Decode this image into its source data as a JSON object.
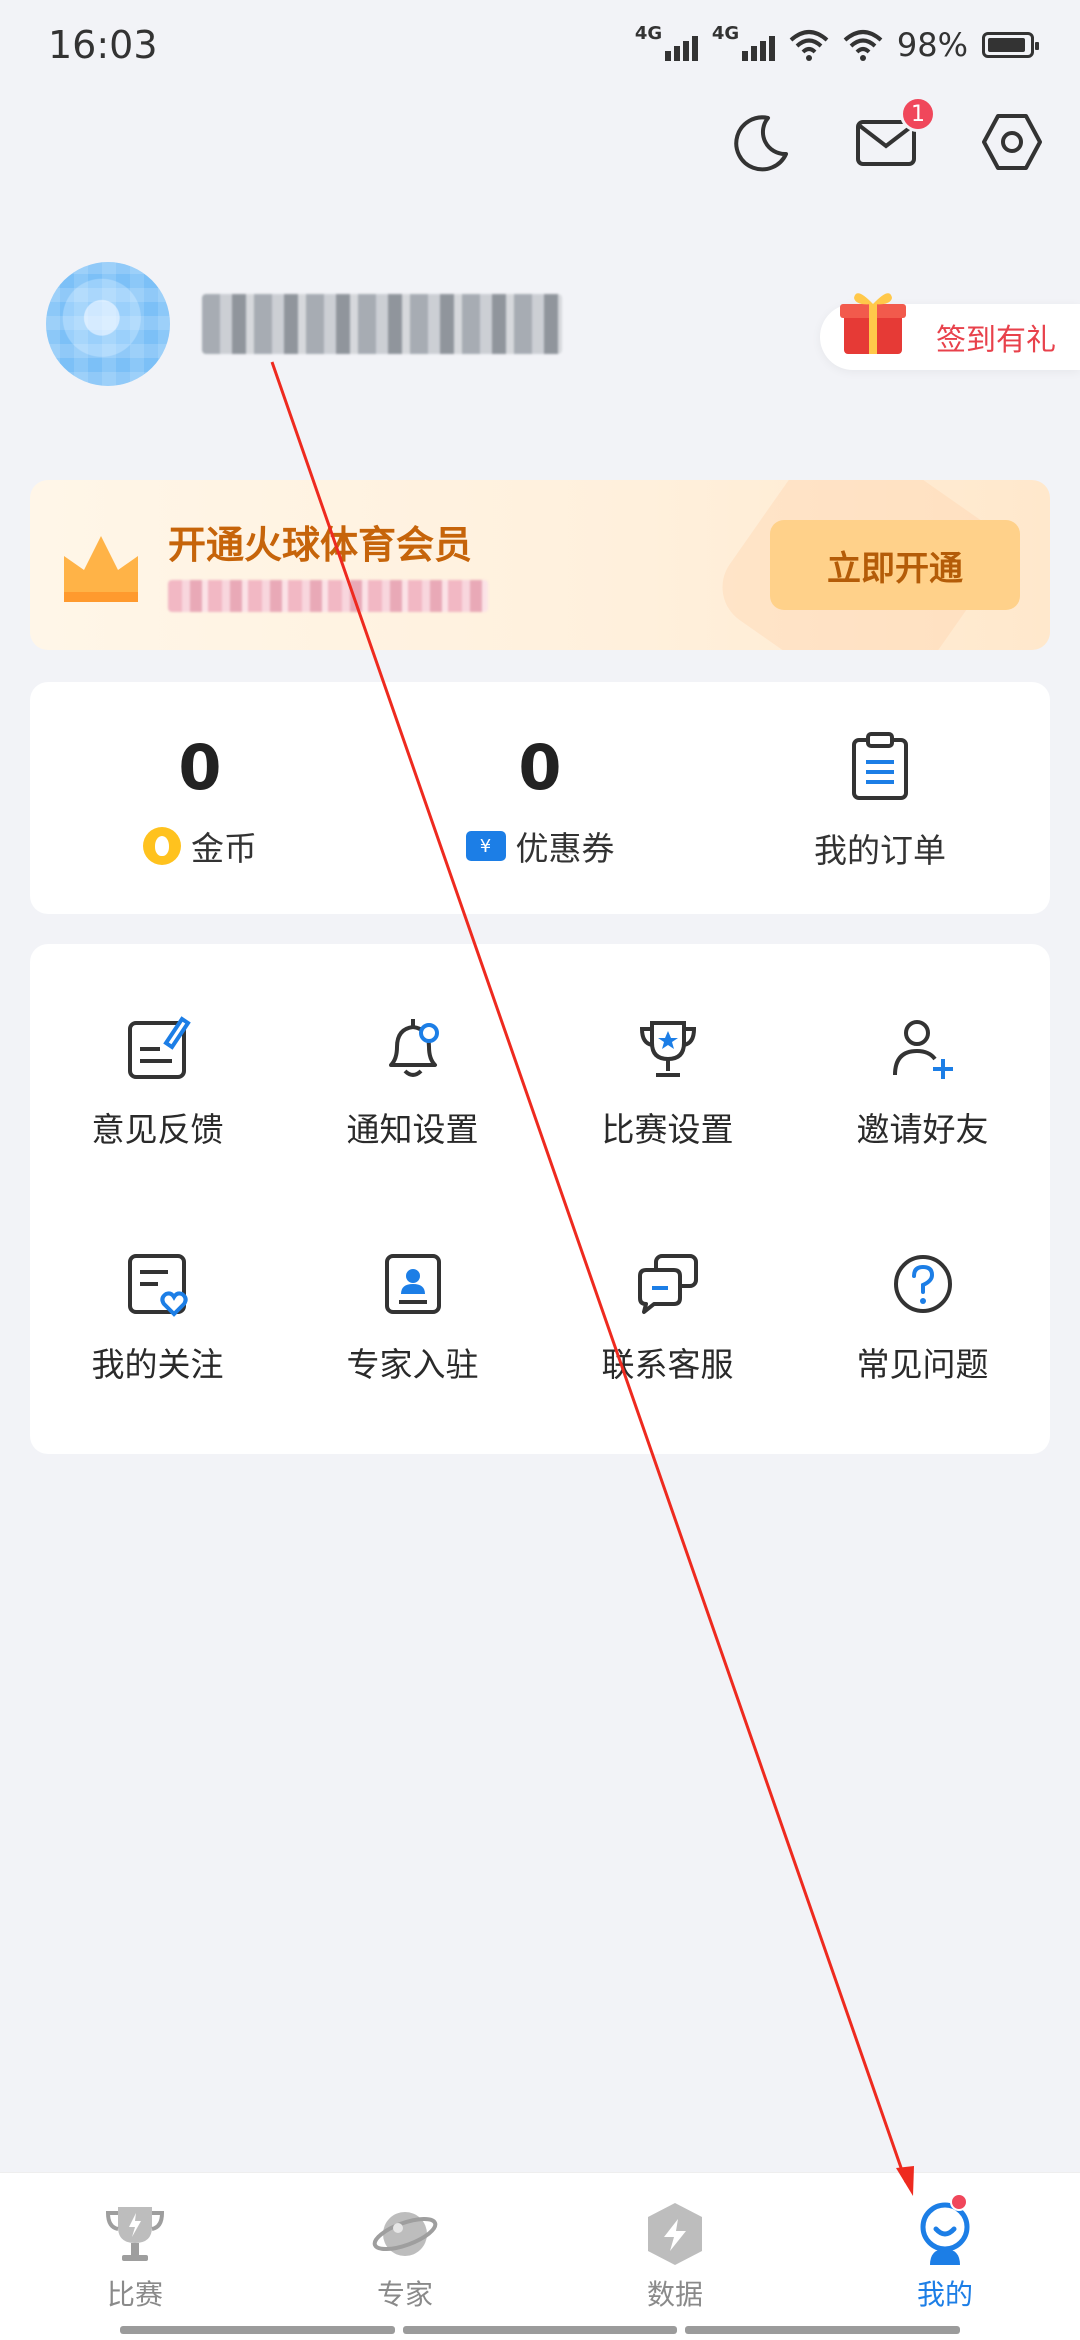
{
  "status": {
    "time": "16:03",
    "net1": "4G",
    "net2": "4G",
    "battery": "98%"
  },
  "signin": {
    "label": "签到有礼"
  },
  "vip": {
    "title": "开通火球体育会员",
    "button": "立即开通"
  },
  "stats": [
    {
      "value": "0",
      "label": "金币",
      "icon": "coin-icon"
    },
    {
      "value": "0",
      "label": "优惠券",
      "icon": "coupon-icon"
    },
    {
      "label": "我的订单",
      "icon": "clipboard-icon"
    }
  ],
  "grid": [
    {
      "label": "意见反馈",
      "icon": "feedback-icon"
    },
    {
      "label": "通知设置",
      "icon": "bell-icon"
    },
    {
      "label": "比赛设置",
      "icon": "trophy-icon"
    },
    {
      "label": "邀请好友",
      "icon": "add-user-icon"
    },
    {
      "label": "我的关注",
      "icon": "follow-icon"
    },
    {
      "label": "专家入驻",
      "icon": "expert-icon"
    },
    {
      "label": "联系客服",
      "icon": "chat-icon"
    },
    {
      "label": "常见问题",
      "icon": "question-icon"
    }
  ],
  "messages": {
    "badge": "1"
  },
  "tabs": [
    {
      "label": "比赛",
      "icon": "trophy-icon"
    },
    {
      "label": "专家",
      "icon": "planet-icon"
    },
    {
      "label": "数据",
      "icon": "data-icon"
    },
    {
      "label": "我的",
      "icon": "mine-icon",
      "active": true
    }
  ],
  "colors": {
    "accent": "#1c7ee6",
    "vip": "#c6640a",
    "badge": "#f0475b",
    "arrow": "#ee2a1f"
  }
}
